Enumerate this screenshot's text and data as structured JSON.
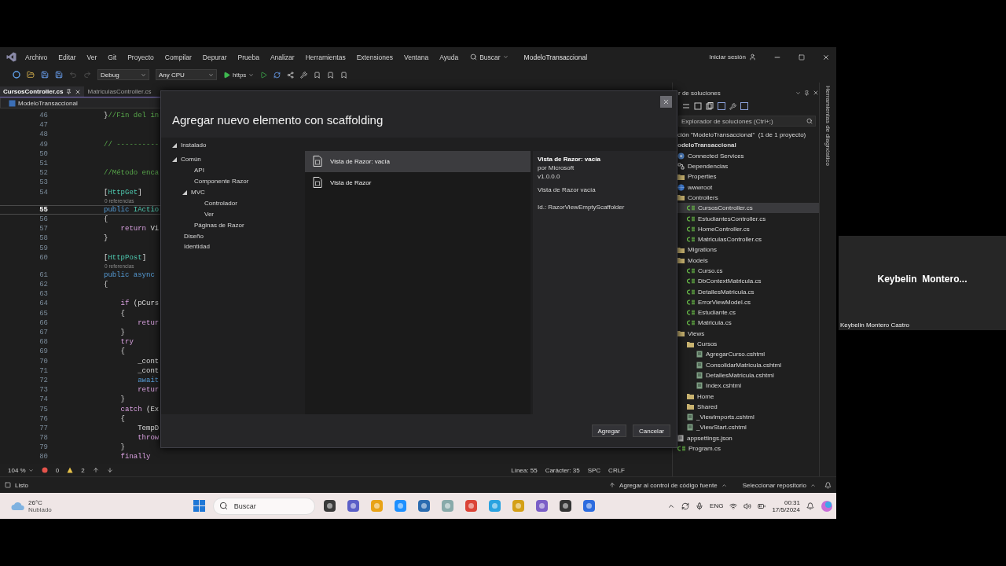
{
  "menu_bar": {
    "items": [
      "Archivo",
      "Editar",
      "Ver",
      "Git",
      "Proyecto",
      "Compilar",
      "Depurar",
      "Prueba",
      "Analizar",
      "Herramientas",
      "Extensiones",
      "Ventana",
      "Ayuda"
    ],
    "search": "Buscar",
    "title": "ModeloTransaccional",
    "sign_in": "Iniciar sesión"
  },
  "toolbar": {
    "configuration": "Debug",
    "platform": "Any CPU",
    "run_target": "https"
  },
  "tabs": [
    {
      "label": "CursosController.cs",
      "selected": true
    },
    {
      "label": "MatriculasController.cs",
      "selected": false
    }
  ],
  "nav_bar": "ModeloTransaccional",
  "code_lines": [
    {
      "kind": "code",
      "n": "46",
      "current": false,
      "tokens": [
        {
          "text": "}",
          "kind": "plain"
        },
        {
          "text": "//Fin del in",
          "kind": "comment"
        }
      ]
    },
    {
      "kind": "code",
      "n": "47",
      "current": false
    },
    {
      "kind": "code",
      "n": "48",
      "current": false
    },
    {
      "kind": "code",
      "n": "49",
      "current": false,
      "tokens": [
        {
          "text": "// ----------",
          "kind": "comment"
        }
      ]
    },
    {
      "kind": "code",
      "n": "50",
      "current": false
    },
    {
      "kind": "code",
      "n": "51",
      "current": false
    },
    {
      "kind": "code",
      "n": "52",
      "current": false,
      "tokens": [
        {
          "text": "//Método enca",
          "kind": "comment"
        }
      ]
    },
    {
      "kind": "code",
      "n": "53",
      "current": false
    },
    {
      "kind": "code",
      "n": "54",
      "current": false,
      "tokens": [
        {
          "text": "[",
          "kind": "plain"
        },
        {
          "text": "HttpGet",
          "kind": "type"
        },
        {
          "text": "]",
          "kind": "plain"
        }
      ]
    },
    {
      "kind": "codelens",
      "text": "0 referencias"
    },
    {
      "kind": "code",
      "n": "55",
      "current": true,
      "tokens": [
        {
          "text": "public",
          "kind": "kw"
        },
        {
          "text": " IActio",
          "kind": "type"
        }
      ]
    },
    {
      "kind": "code",
      "n": "56",
      "current": false,
      "tokens": [
        {
          "text": "{",
          "kind": "plain"
        }
      ]
    },
    {
      "kind": "code",
      "n": "57",
      "current": false,
      "tokens": [
        {
          "text": "    return",
          "kind": "ctrl"
        },
        {
          "text": " Vi",
          "kind": "plain"
        }
      ]
    },
    {
      "kind": "code",
      "n": "58",
      "current": false,
      "tokens": [
        {
          "text": "}",
          "kind": "plain"
        }
      ]
    },
    {
      "kind": "code",
      "n": "59",
      "current": false
    },
    {
      "kind": "code",
      "n": "60",
      "current": false,
      "tokens": [
        {
          "text": "[",
          "kind": "plain"
        },
        {
          "text": "HttpPost",
          "kind": "type"
        },
        {
          "text": "]",
          "kind": "plain"
        }
      ]
    },
    {
      "kind": "codelens",
      "text": "0 referencias"
    },
    {
      "kind": "code",
      "n": "61",
      "current": false,
      "tokens": [
        {
          "text": "public async",
          "kind": "kw"
        }
      ]
    },
    {
      "kind": "code",
      "n": "62",
      "current": false,
      "tokens": [
        {
          "text": "{",
          "kind": "plain"
        }
      ]
    },
    {
      "kind": "code",
      "n": "63",
      "current": false
    },
    {
      "kind": "code",
      "n": "64",
      "current": false,
      "tokens": [
        {
          "text": "    if",
          "kind": "ctrl"
        },
        {
          "text": " (pCurs",
          "kind": "plain"
        }
      ]
    },
    {
      "kind": "code",
      "n": "65",
      "current": false,
      "tokens": [
        {
          "text": "    {",
          "kind": "plain"
        }
      ]
    },
    {
      "kind": "code",
      "n": "66",
      "current": false,
      "tokens": [
        {
          "text": "        retur",
          "kind": "ctrl"
        }
      ]
    },
    {
      "kind": "code",
      "n": "67",
      "current": false,
      "tokens": [
        {
          "text": "    }",
          "kind": "plain"
        }
      ]
    },
    {
      "kind": "code",
      "n": "68",
      "current": false,
      "tokens": [
        {
          "text": "    try",
          "kind": "ctrl"
        }
      ]
    },
    {
      "kind": "code",
      "n": "69",
      "current": false,
      "tokens": [
        {
          "text": "    {",
          "kind": "plain"
        }
      ]
    },
    {
      "kind": "code",
      "n": "70",
      "current": false,
      "tokens": [
        {
          "text": "        _cont",
          "kind": "plain"
        }
      ]
    },
    {
      "kind": "code",
      "n": "71",
      "current": false,
      "tokens": [
        {
          "text": "        _cont",
          "kind": "plain"
        }
      ]
    },
    {
      "kind": "code",
      "n": "72",
      "current": false,
      "tokens": [
        {
          "text": "        await",
          "kind": "kw"
        }
      ]
    },
    {
      "kind": "code",
      "n": "73",
      "current": false,
      "tokens": [
        {
          "text": "        retur",
          "kind": "ctrl"
        }
      ]
    },
    {
      "kind": "code",
      "n": "74",
      "current": false,
      "tokens": [
        {
          "text": "    }",
          "kind": "plain"
        }
      ]
    },
    {
      "kind": "code",
      "n": "75",
      "current": false,
      "tokens": [
        {
          "text": "    catch",
          "kind": "ctrl"
        },
        {
          "text": " (Ex",
          "kind": "plain"
        }
      ]
    },
    {
      "kind": "code",
      "n": "76",
      "current": false,
      "tokens": [
        {
          "text": "    {",
          "kind": "plain"
        }
      ]
    },
    {
      "kind": "code",
      "n": "77",
      "current": false,
      "tokens": [
        {
          "text": "        TempD",
          "kind": "plain"
        }
      ]
    },
    {
      "kind": "code",
      "n": "78",
      "current": false,
      "tokens": [
        {
          "text": "        throw",
          "kind": "ctrl"
        }
      ]
    },
    {
      "kind": "code",
      "n": "79",
      "current": false,
      "tokens": [
        {
          "text": "    }",
          "kind": "plain"
        }
      ]
    },
    {
      "kind": "code",
      "n": "80",
      "current": false,
      "tokens": [
        {
          "text": "    finally",
          "kind": "ctrl"
        }
      ]
    }
  ],
  "editor_status": {
    "zoom": "104 %",
    "errors": "0",
    "warnings": "2",
    "line": "Línea: 55",
    "column": "Carácter: 35",
    "indent": "SPC",
    "line_ending": "CRLF"
  },
  "dialog": {
    "title": "Agregar nuevo elemento con scaffolding",
    "tree": [
      {
        "label": "Instalado",
        "expanded": true,
        "children": [
          {
            "label": "Común",
            "expanded": true,
            "children": [
              {
                "label": "API"
              },
              {
                "label": "Componente Razor"
              },
              {
                "label": "MVC",
                "expanded": true,
                "children": [
                  {
                    "label": "Controlador"
                  },
                  {
                    "label": "Ver"
                  }
                ]
              },
              {
                "label": "Páginas de Razor"
              }
            ]
          },
          {
            "label": "Diseño"
          },
          {
            "label": "Identidad"
          }
        ]
      }
    ],
    "templates": [
      {
        "label": "Vista de Razor: vacía",
        "selected": true
      },
      {
        "label": "Vista de Razor",
        "selected": false
      }
    ],
    "details": {
      "name": "Vista de Razor: vacía",
      "author": "por Microsoft",
      "version": "v1.0.0.0",
      "description": "Vista de Razor vacía",
      "id": "Id.: RazorViewEmptyScaffolder"
    },
    "buttons": [
      "Agregar",
      "Cancelar"
    ]
  },
  "solution_explorer": {
    "title": "r de soluciones",
    "search": {
      "placeholder": "Explorador de soluciones (Ctrl+;)"
    },
    "solution": "ción \"ModeloTransaccional\"  (1 de 1 proyecto)",
    "project": "odeloTransaccional",
    "tree": [
      {
        "label": "Connected Services",
        "kind": "service",
        "selected": false
      },
      {
        "label": "Dependencias",
        "kind": "deps",
        "selected": false
      },
      {
        "label": "Properties",
        "kind": "folder",
        "selected": false
      },
      {
        "label": "wwwroot",
        "kind": "web",
        "selected": false
      },
      {
        "label": "Controllers",
        "kind": "folder",
        "selected": false,
        "children": [
          {
            "label": "CursosController.cs",
            "kind": "cs",
            "selected": true
          },
          {
            "label": "EstudiantesController.cs",
            "kind": "cs",
            "selected": false
          },
          {
            "label": "HomeController.cs",
            "kind": "cs",
            "selected": false
          },
          {
            "label": "MatriculasController.cs",
            "kind": "cs",
            "selected": false
          }
        ]
      },
      {
        "label": "Migrations",
        "kind": "folder",
        "selected": false
      },
      {
        "label": "Models",
        "kind": "folder",
        "selected": false,
        "children": [
          {
            "label": "Curso.cs",
            "kind": "cs",
            "selected": false
          },
          {
            "label": "DbContextMatricula.cs",
            "kind": "cs",
            "selected": false
          },
          {
            "label": "DetallesMatricula.cs",
            "kind": "cs",
            "selected": false
          },
          {
            "label": "ErrorViewModel.cs",
            "kind": "cs",
            "selected": false
          },
          {
            "label": "Estudiante.cs",
            "kind": "cs",
            "selected": false
          },
          {
            "label": "Matricula.cs",
            "kind": "cs",
            "selected": false
          }
        ]
      },
      {
        "label": "Views",
        "kind": "folder",
        "selected": false,
        "children": [
          {
            "label": "Cursos",
            "kind": "folder",
            "selected": false,
            "children": [
              {
                "label": "AgregarCurso.cshtml",
                "kind": "page",
                "selected": false
              },
              {
                "label": "ConsolidarMatricula.cshtml",
                "kind": "page",
                "selected": false
              },
              {
                "label": "DetallesMatricula.cshtml",
                "kind": "page",
                "selected": false
              },
              {
                "label": "Index.cshtml",
                "kind": "page",
                "selected": false
              }
            ]
          },
          {
            "label": "Home",
            "kind": "folder",
            "selected": false
          },
          {
            "label": "Shared",
            "kind": "folder",
            "selected": false
          },
          {
            "label": "_ViewImports.cshtml",
            "kind": "page",
            "selected": false
          },
          {
            "label": "_ViewStart.cshtml",
            "kind": "page",
            "selected": false
          }
        ]
      },
      {
        "label": "appsettings.json",
        "kind": "json",
        "selected": false
      },
      {
        "label": "Program.cs",
        "kind": "cs",
        "selected": false
      }
    ]
  },
  "side_tab": "Herramientas de diagnóstico",
  "status_bar": {
    "state": "Listo",
    "source_control": "Agregar al control de código fuente",
    "repository": "Seleccionar repositorio"
  },
  "taskbar": {
    "temperature": "26°C",
    "weather": "Nublado",
    "search": {
      "placeholder": "Buscar"
    },
    "language": "ENG",
    "time": "00:31",
    "date": "17/5/2024"
  },
  "participant": {
    "tile_name": "Keybelin  Montero...",
    "name": "Keybelin Montero Castro"
  }
}
